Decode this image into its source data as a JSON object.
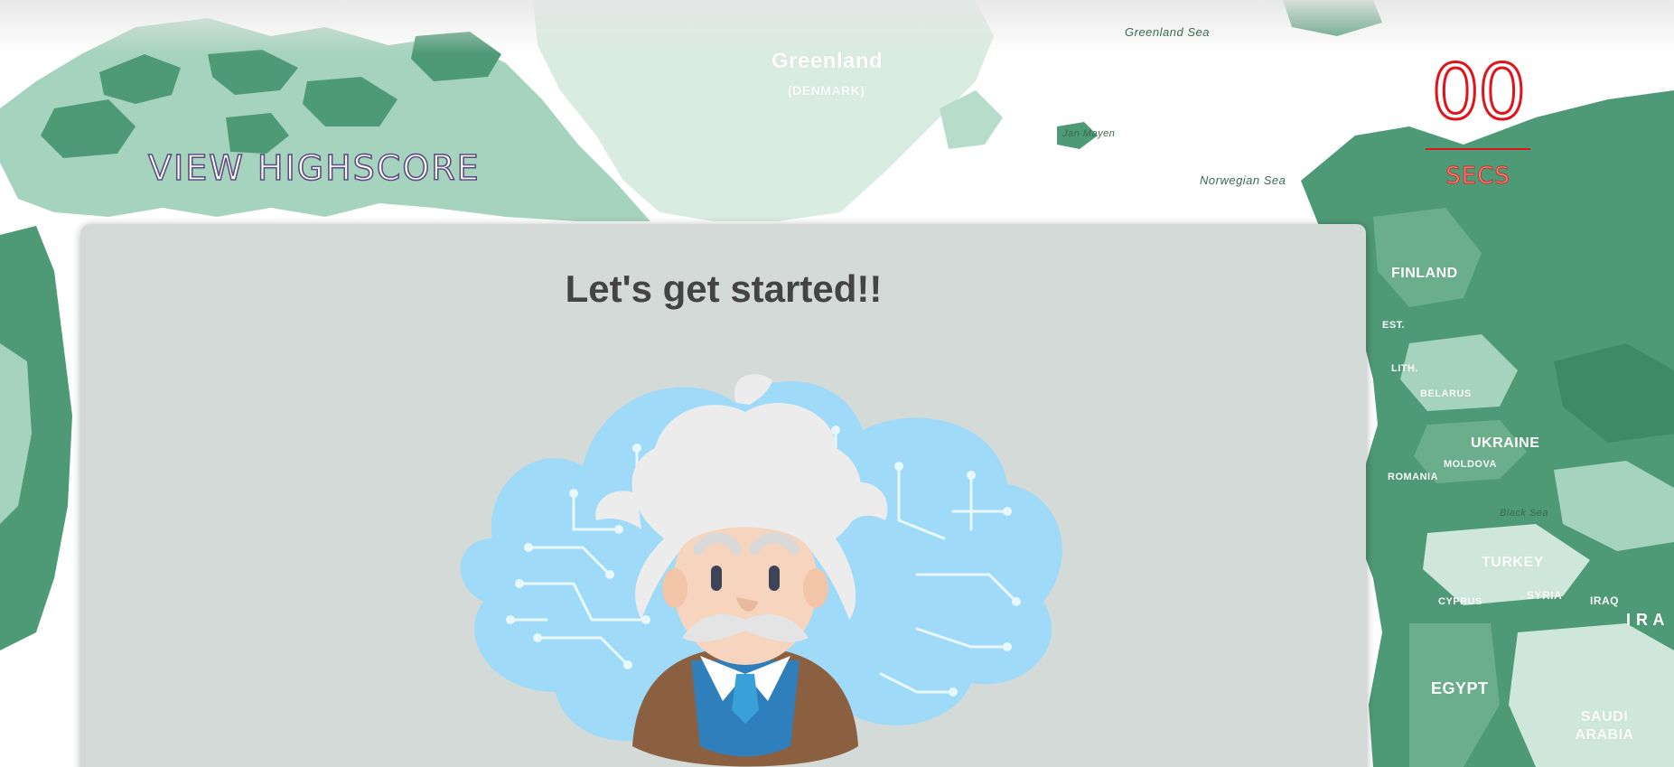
{
  "map": {
    "labels": {
      "greenland": "Greenland",
      "denmark": "(DENMARK)",
      "greenland_sea": "Greenland Sea",
      "jan_mayen": "Jan Mayen",
      "norwegian_sea": "Norwegian Sea",
      "finland": "FINLAND",
      "est": "EST.",
      "lith": "LITH.",
      "belarus": "BELARUS",
      "ukraine": "UKRAINE",
      "moldova": "MOLDOVA",
      "romania": "ROMANIA",
      "black_sea": "Black Sea",
      "turkey": "TURKEY",
      "cyprus": "CYPRUS",
      "syria": "SYRIA",
      "iraq": "IRAQ",
      "egypt": "EGYPT",
      "saudi_arabia": "SAUDI ARABIA",
      "ira": "I R A"
    },
    "colors": {
      "land": "#4f9a76",
      "land_light": "#a6d3bd",
      "ice": "#d9ece2",
      "water": "#ffffff"
    }
  },
  "header": {
    "view_highscore_label": "VIEW HIGHSCORE"
  },
  "timer": {
    "value": "00",
    "unit": "SECS",
    "color": "#e0151c"
  },
  "card": {
    "title": "Let's get started!!",
    "background": "#d4dad7"
  },
  "mascot": {
    "icon": "einstein-mascot-icon",
    "cloud_color": "#9fdaf9",
    "circuit_color": "#e9f7ff"
  }
}
